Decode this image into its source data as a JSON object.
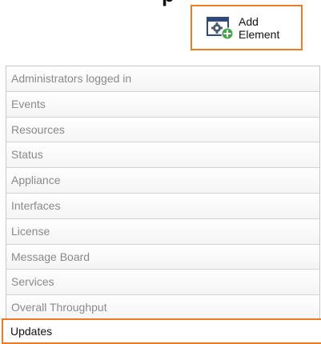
{
  "header": {
    "title_fragment": "p"
  },
  "toolbar": {
    "add_element_line1": "Add",
    "add_element_line2": "Element",
    "add_element_icon": "gear-plus-icon",
    "highlight_color": "#ee7a22"
  },
  "elements_list": {
    "items": [
      {
        "label": "Administrators logged in"
      },
      {
        "label": "Events"
      },
      {
        "label": "Resources"
      },
      {
        "label": "Status"
      },
      {
        "label": "Appliance"
      },
      {
        "label": "Interfaces"
      },
      {
        "label": "License"
      },
      {
        "label": "Message Board"
      },
      {
        "label": "Services"
      },
      {
        "label": "Overall Throughput"
      }
    ],
    "selected": {
      "label": "Updates"
    }
  }
}
